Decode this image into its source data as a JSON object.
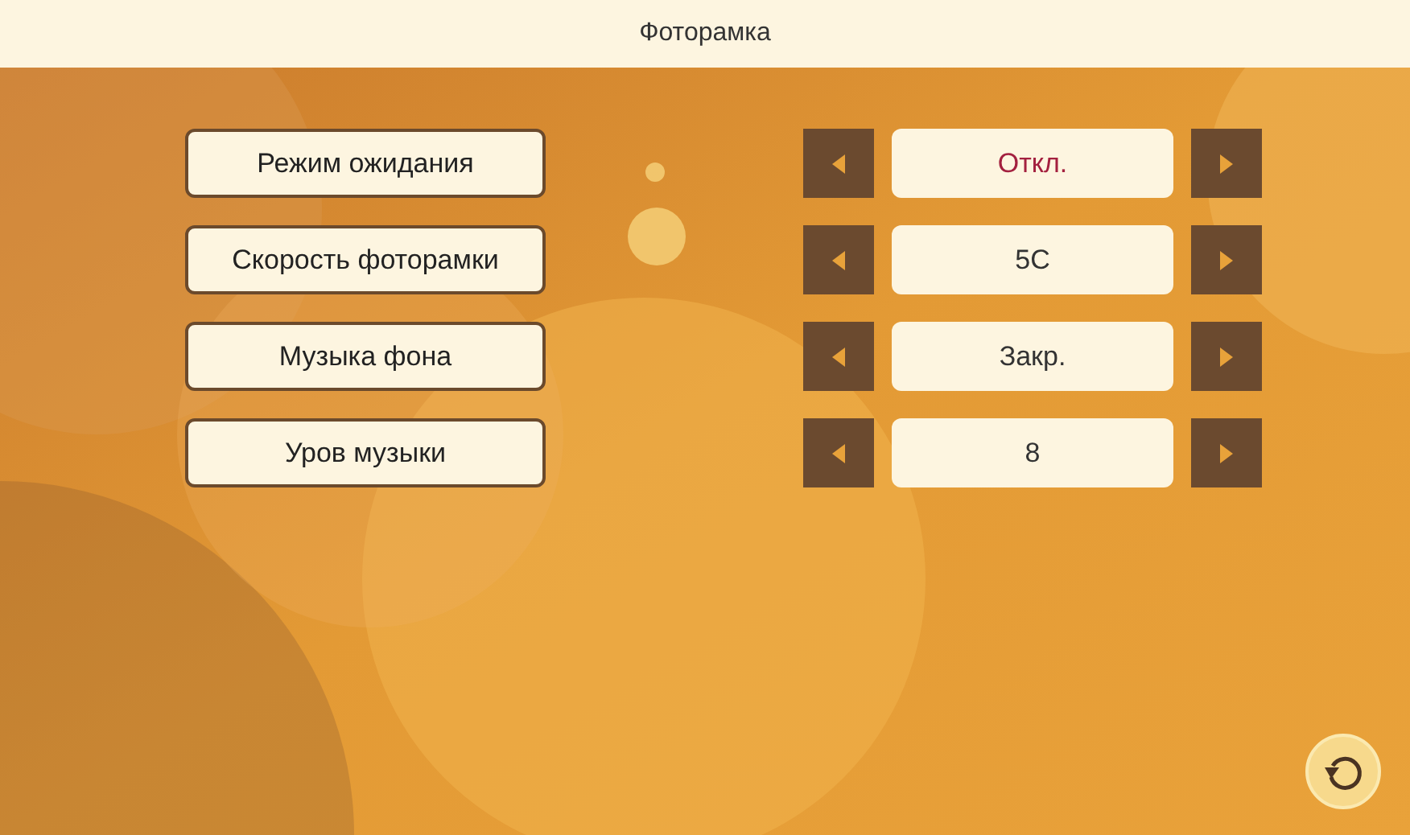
{
  "title": "Фоторамка",
  "settings": [
    {
      "label": "Режим ожидания",
      "value": "Откл.",
      "selected": true
    },
    {
      "label": "Скорость фоторамки",
      "value": "5С",
      "selected": false
    },
    {
      "label": "Музыка фона",
      "value": "Закр.",
      "selected": false
    },
    {
      "label": "Уров музыки",
      "value": "8",
      "selected": false
    }
  ]
}
